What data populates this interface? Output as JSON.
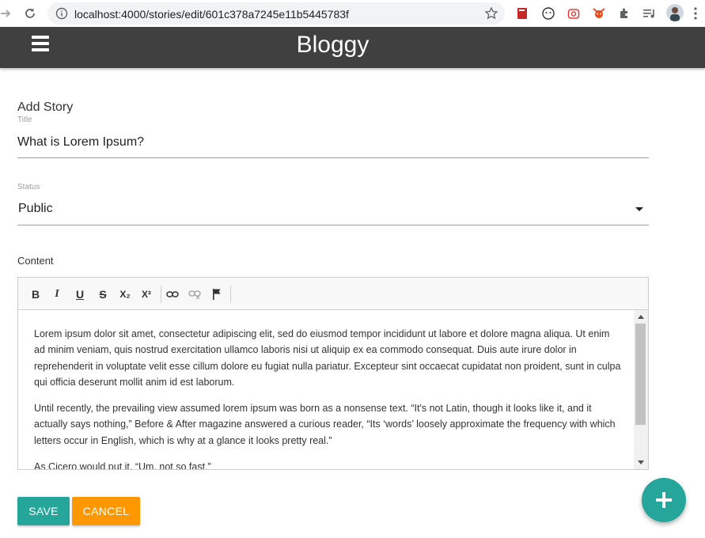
{
  "browser": {
    "url": "localhost:4000/stories/edit/601c378a7245e11b5445783f"
  },
  "header": {
    "brand": "Bloggy"
  },
  "form": {
    "heading": "Add Story",
    "title_label": "Title",
    "title_value": "What is Lorem Ipsum?",
    "status_label": "Status",
    "status_value": "Public",
    "content_label": "Content"
  },
  "editor": {
    "toolbar": [
      "B",
      "I",
      "U",
      "S",
      "X₂",
      "X²",
      "link",
      "unlink",
      "flag"
    ],
    "paragraphs": [
      "Lorem ipsum dolor sit amet, consectetur adipiscing elit, sed do eiusmod tempor incididunt ut labore et dolore magna aliqua. Ut enim ad minim veniam, quis nostrud exercitation ullamco laboris nisi ut aliquip ex ea commodo consequat. Duis aute irure dolor in reprehenderit in voluptate velit esse cillum dolore eu fugiat nulla pariatur. Excepteur sint occaecat cupidatat non proident, sunt in culpa qui officia deserunt mollit anim id est laborum.",
      "Until recently, the prevailing view assumed lorem ipsum was born as a nonsense text. “It's not Latin, though it looks like it, and it actually says nothing,” Before & After magazine answered a curious reader, “Its ‘words’ loosely approximate the frequency with which letters occur in English, which is why at a glance it looks pretty real.”",
      "As Cicero would put it, “Um, not so fast.”"
    ]
  },
  "actions": {
    "save_label": "SAVE",
    "cancel_label": "CANCEL",
    "fab_label": "+"
  },
  "colors": {
    "header_bg": "#404040",
    "save_bg": "#26a69a",
    "cancel_bg": "#ff9800",
    "fab_bg": "#26a69a"
  }
}
